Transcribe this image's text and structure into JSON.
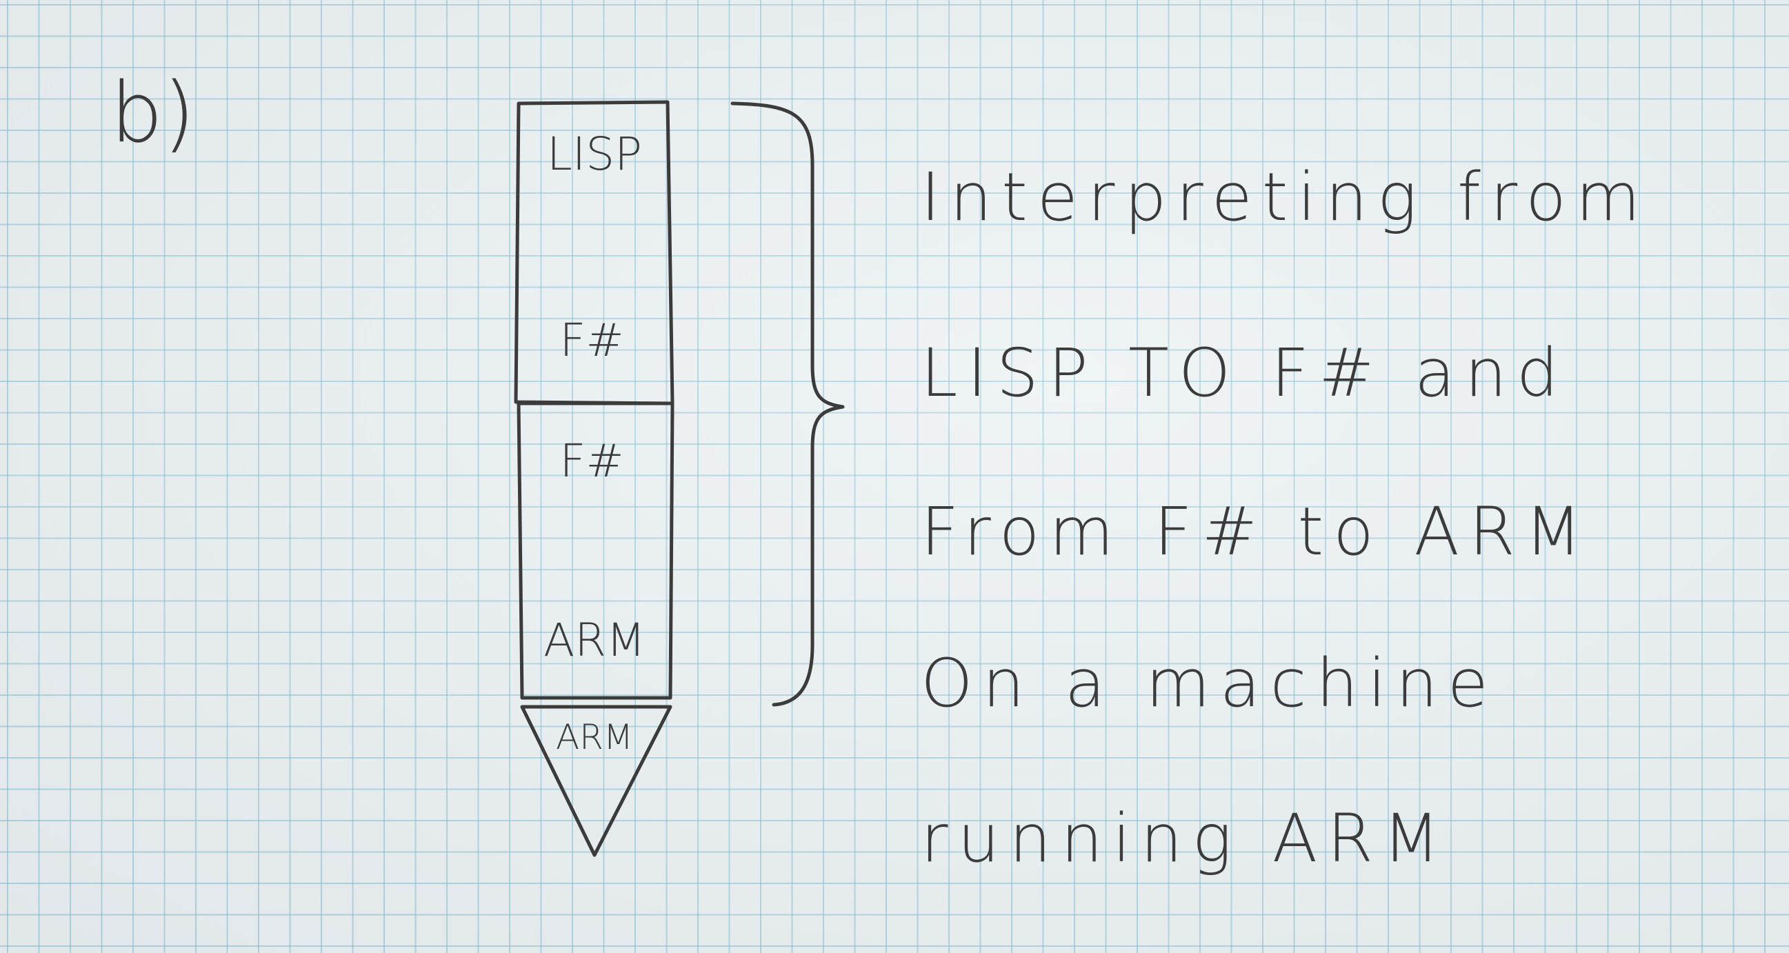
{
  "part_label": "b)",
  "diagram": {
    "upper_box": {
      "top_label": "LISP",
      "bottom_label": "F#"
    },
    "lower_box": {
      "top_label": "F#",
      "bottom_label": "ARM"
    },
    "machine_label": "ARM"
  },
  "note": {
    "lines": [
      "Interpreting from",
      "LISP TO F# and",
      "From F# to ARM",
      "On a machine",
      "running ARM"
    ]
  },
  "colors": {
    "pencil": "#3b3b3b",
    "grid": "#78b9cd",
    "paper": "#eaf0f2"
  }
}
